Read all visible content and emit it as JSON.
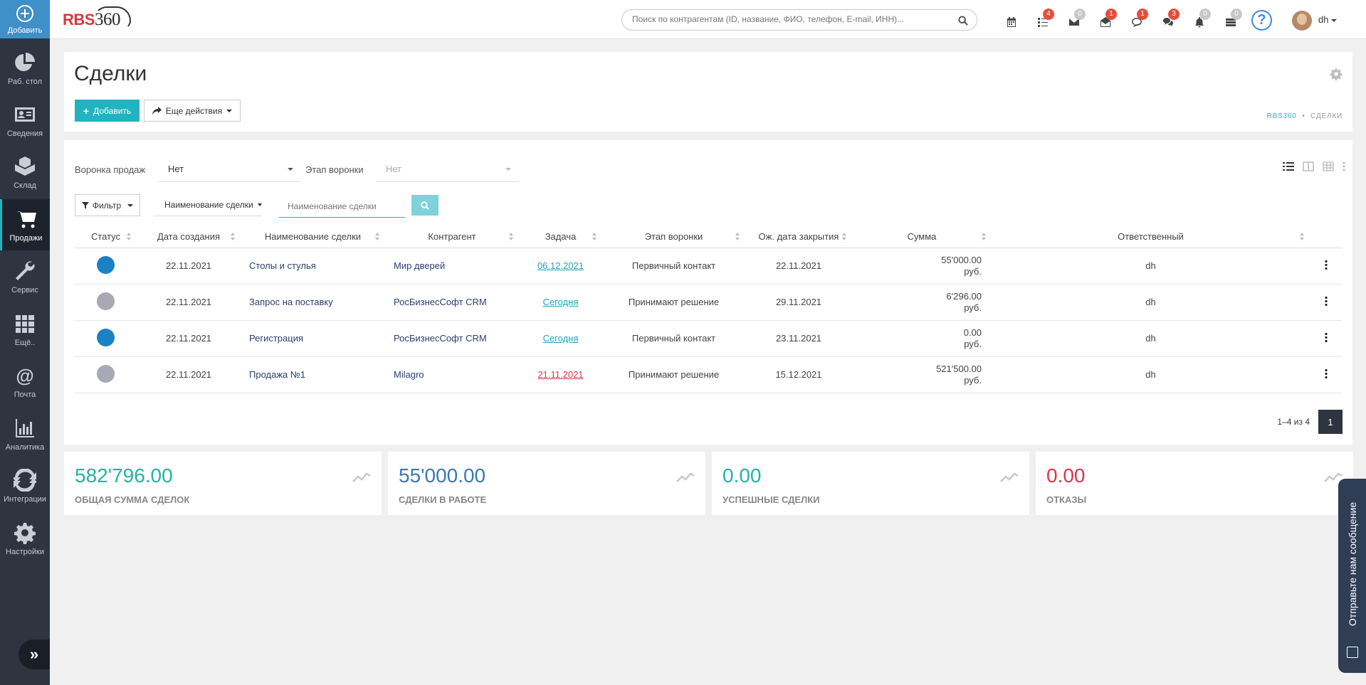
{
  "sidebar": {
    "add_label": "Добавить",
    "items": [
      {
        "label": "Раб. стол",
        "icon": "pie-chart-icon"
      },
      {
        "label": "Сведения",
        "icon": "id-card-icon"
      },
      {
        "label": "Склад",
        "icon": "boxes-icon"
      },
      {
        "label": "Продажи",
        "icon": "cart-icon"
      },
      {
        "label": "Сервис",
        "icon": "wrench-icon"
      },
      {
        "label": "Ещё..",
        "icon": "grid-icon"
      },
      {
        "label": "Почта",
        "icon": "at-icon"
      },
      {
        "label": "Аналитика",
        "icon": "bar-chart-icon"
      },
      {
        "label": "Интеграции",
        "icon": "refresh-icon"
      },
      {
        "label": "Настройки",
        "icon": "gear-icon"
      }
    ],
    "expand_icon": "»"
  },
  "topbar": {
    "logo_text": "RBS",
    "logo_num": "360",
    "search_placeholder": "Поиск по контрагентам (ID, название, ФИО, телефон, E-mail, ИНН)...",
    "icons": [
      {
        "name": "calendar-icon",
        "badge": ""
      },
      {
        "name": "tasks-icon",
        "badge": "4",
        "badge_color": "#e74c3c"
      },
      {
        "name": "mail-icon",
        "badge": "0",
        "badge_color": "#c8c8c8"
      },
      {
        "name": "mail-open-icon",
        "badge": "1",
        "badge_color": "#e74c3c"
      },
      {
        "name": "comment-icon",
        "badge": "1",
        "badge_color": "#e74c3c"
      },
      {
        "name": "comments-icon",
        "badge": "3",
        "badge_color": "#e74c3c"
      },
      {
        "name": "bell-icon",
        "badge": "0",
        "badge_color": "#c8c8c8"
      },
      {
        "name": "stack-icon",
        "badge": "0",
        "badge_color": "#c8c8c8"
      }
    ],
    "help": "?",
    "user": "dh"
  },
  "header": {
    "title": "Сделки",
    "add_label": "Добавить",
    "more_label": "Еще действия",
    "breadcrumb_root": "RBS360",
    "breadcrumb_sep": "•",
    "breadcrumb_current": "СДЕЛКИ"
  },
  "filters": {
    "funnel_label": "Воронка продаж",
    "funnel_value": "Нет",
    "stage_label": "Этап воронки",
    "stage_value": "Нет",
    "filter_label": "Фильтр",
    "field_label": "Наименование сделки",
    "search_placeholder": "Наименование сделки"
  },
  "table": {
    "columns": [
      "Статус",
      "Дата создания",
      "Наименование сделки",
      "Контрагент",
      "Задача",
      "Этап воронки",
      "Ож. дата закрытия",
      "Сумма",
      "Ответственный"
    ],
    "rows": [
      {
        "status_color": "#1a81c5",
        "created": "22.11.2021",
        "name": "Столы и стулья",
        "contractor": "Мир дверей",
        "task": "06.12.2021",
        "task_overdue": false,
        "stage": "Первичный контакт",
        "close": "22.11.2021",
        "amount": "55'000.00",
        "currency": "руб.",
        "owner": "dh"
      },
      {
        "status_color": "#a9a9b5",
        "created": "22.11.2021",
        "name": "Запрос на поставку",
        "contractor": "РосБизнесСофт CRM",
        "task": "Сегодня",
        "task_overdue": false,
        "stage": "Принимают решение",
        "close": "29.11.2021",
        "amount": "6'296.00",
        "currency": "руб.",
        "owner": "dh"
      },
      {
        "status_color": "#1a81c5",
        "created": "22.11.2021",
        "name": "Регистрация",
        "contractor": "РосБизнесСофт CRM",
        "task": "Сегодня",
        "task_overdue": false,
        "stage": "Первичный контакт",
        "close": "23.11.2021",
        "amount": "0.00",
        "currency": "руб.",
        "owner": "dh"
      },
      {
        "status_color": "#a9a9b5",
        "created": "22.11.2021",
        "name": "Продажа №1",
        "contractor": "Milagro",
        "task": "21.11.2021",
        "task_overdue": true,
        "stage": "Принимают решение",
        "close": "15.12.2021",
        "amount": "521'500.00",
        "currency": "руб.",
        "owner": "dh"
      }
    ]
  },
  "pagination": {
    "range": "1–4 из 4",
    "page": "1"
  },
  "stats": [
    {
      "value": "582'796.00",
      "label": "ОБЩАЯ СУММА СДЕЛОК",
      "color": "#22b3a3"
    },
    {
      "value": "55'000.00",
      "label": "СДЕЛКИ В РАБОТЕ",
      "color": "#3a78b5"
    },
    {
      "value": "0.00",
      "label": "УСПЕШНЫЕ СДЕЛКИ",
      "color": "#22b3a3"
    },
    {
      "value": "0.00",
      "label": "ОТКАЗЫ",
      "color": "#e0334a"
    }
  ],
  "feedback": {
    "label": "Отправьте нам сообщение"
  }
}
